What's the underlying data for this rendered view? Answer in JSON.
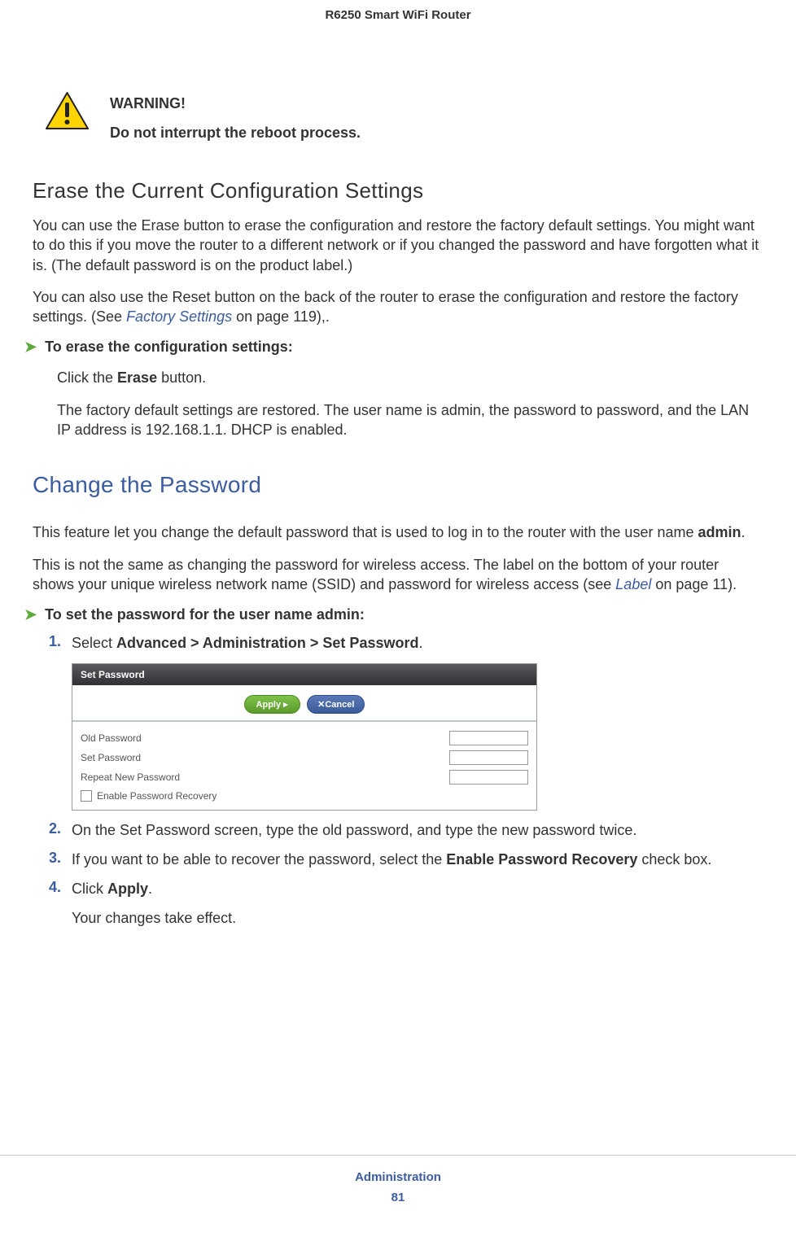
{
  "header": {
    "title": "R6250 Smart WiFi Router"
  },
  "warning": {
    "label": "WARNING!",
    "message": "Do not interrupt the reboot process."
  },
  "section1": {
    "heading": "Erase the Current Configuration Settings",
    "para1": "You can use the Erase button to erase the configuration and restore the factory default settings. You might want to do this if you move the router to a different network or if you changed the password and have forgotten what it is. (The default password is on the product label.)",
    "para2_a": "You can also use the Reset button on the back of the router to erase the configuration and restore the factory settings. (See ",
    "para2_link": "Factory Settings",
    "para2_b": " on page 119),.",
    "task": "To erase the configuration settings:",
    "step_a": "Click the ",
    "step_b": "Erase",
    "step_c": " button.",
    "result": "The factory default settings are restored. The user name is admin, the password to password, and the LAN IP address is 192.168.1.1. DHCP is enabled."
  },
  "section2": {
    "heading": "Change the Password",
    "para1_a": "This feature let you change the default password that is used to log in to the router with the user name ",
    "para1_b": "admin",
    "para1_c": ".",
    "para2_a": "This is not the same as changing the password for wireless access. The label on the bottom of your router shows your unique wireless network name (SSID) and password for wireless access (see ",
    "para2_link": "Label",
    "para2_b": " on page 11).",
    "task": "To set the password for the user name admin:",
    "steps": {
      "s1_num": "1.",
      "s1_a": "Select ",
      "s1_b": "Advanced > Administration > Set Password",
      "s1_c": ".",
      "s2_num": "2.",
      "s2": "On the Set Password screen, type the old password, and type the new password twice.",
      "s3_num": "3.",
      "s3_a": "If you want to be able to recover the password, select the ",
      "s3_b": "Enable Password Recovery",
      "s3_c": " check box.",
      "s4_num": "4.",
      "s4_a": "Click ",
      "s4_b": "Apply",
      "s4_c": ".",
      "s4_result": "Your changes take effect."
    }
  },
  "screenshot": {
    "title": "Set Password",
    "apply_btn": "Apply ▸",
    "cancel_btn": "✕Cancel",
    "rows": {
      "old": "Old Password",
      "set": "Set Password",
      "repeat": "Repeat New Password",
      "recovery": "Enable Password Recovery"
    }
  },
  "footer": {
    "chapter": "Administration",
    "page": "81"
  }
}
